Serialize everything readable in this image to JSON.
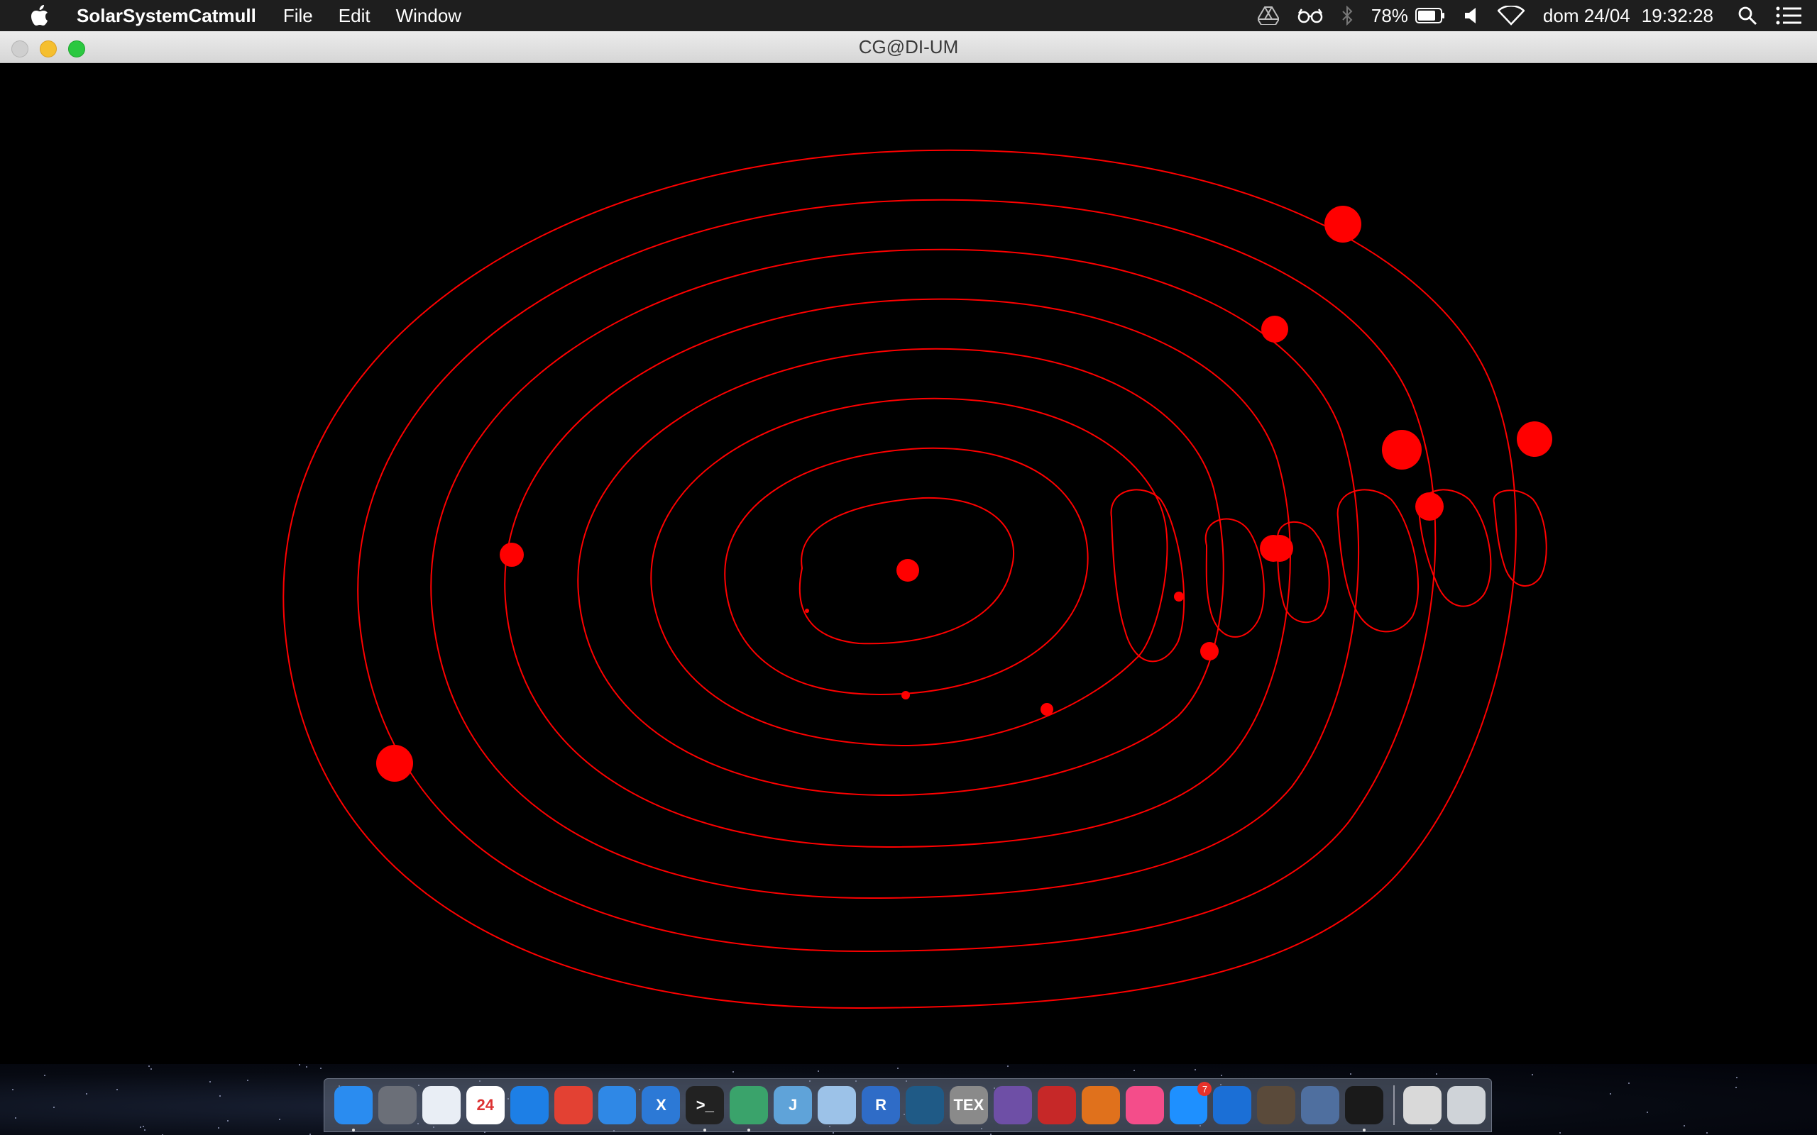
{
  "menubar": {
    "app_name": "SolarSystemCatmull",
    "menus": [
      "File",
      "Edit",
      "Window"
    ],
    "battery": "78%",
    "date": "dom 24/04",
    "time": "19:32:28"
  },
  "window": {
    "title": "CG@DI-UM"
  },
  "scene": {
    "orbit_color": "#ff0000",
    "background": "#000000",
    "body_color": "#ff0000"
  },
  "dock": {
    "items": [
      {
        "name": "finder",
        "label": "",
        "color": "#2a8cf0"
      },
      {
        "name": "launchpad",
        "label": "",
        "color": "#6b6f78"
      },
      {
        "name": "clock",
        "label": "",
        "color": "#e9eef5"
      },
      {
        "name": "calendar",
        "label": "24",
        "color": "#ffffff"
      },
      {
        "name": "safari",
        "label": "",
        "color": "#1d7fe6"
      },
      {
        "name": "chrome",
        "label": "",
        "color": "#e34133"
      },
      {
        "name": "xcode-instruments",
        "label": "",
        "color": "#2f88e6"
      },
      {
        "name": "xcode",
        "label": "X",
        "color": "#2c79d6"
      },
      {
        "name": "terminal",
        "label": ">_",
        "color": "#222222"
      },
      {
        "name": "atom",
        "label": "",
        "color": "#3aa36b"
      },
      {
        "name": "intellij",
        "label": "J",
        "color": "#5fa3d9"
      },
      {
        "name": "virtualbox-cube",
        "label": "",
        "color": "#9cc2e8"
      },
      {
        "name": "r-lang",
        "label": "R",
        "color": "#2f6cc7"
      },
      {
        "name": "mysql-workbench",
        "label": "",
        "color": "#1f5a86"
      },
      {
        "name": "tex",
        "label": "TEX",
        "color": "#8a8a8a"
      },
      {
        "name": "github-desktop",
        "label": "",
        "color": "#6e4fa6"
      },
      {
        "name": "geogebra",
        "label": "",
        "color": "#c62828"
      },
      {
        "name": "matlab",
        "label": "",
        "color": "#e0711c"
      },
      {
        "name": "itunes",
        "label": "",
        "color": "#f44d8a"
      },
      {
        "name": "app-store",
        "label": "",
        "color": "#1e90ff",
        "badge": "7"
      },
      {
        "name": "wireshark",
        "label": "",
        "color": "#1b6fd6"
      },
      {
        "name": "blender",
        "label": "",
        "color": "#5a4a3a"
      },
      {
        "name": "virtualbox",
        "label": "",
        "color": "#4f6f9f"
      },
      {
        "name": "console",
        "label": "",
        "color": "#1a1a1a"
      }
    ],
    "trailing": [
      {
        "name": "downloads-stack",
        "color": "#d9d9d9"
      },
      {
        "name": "trash",
        "color": "#cfd3d8"
      }
    ]
  }
}
